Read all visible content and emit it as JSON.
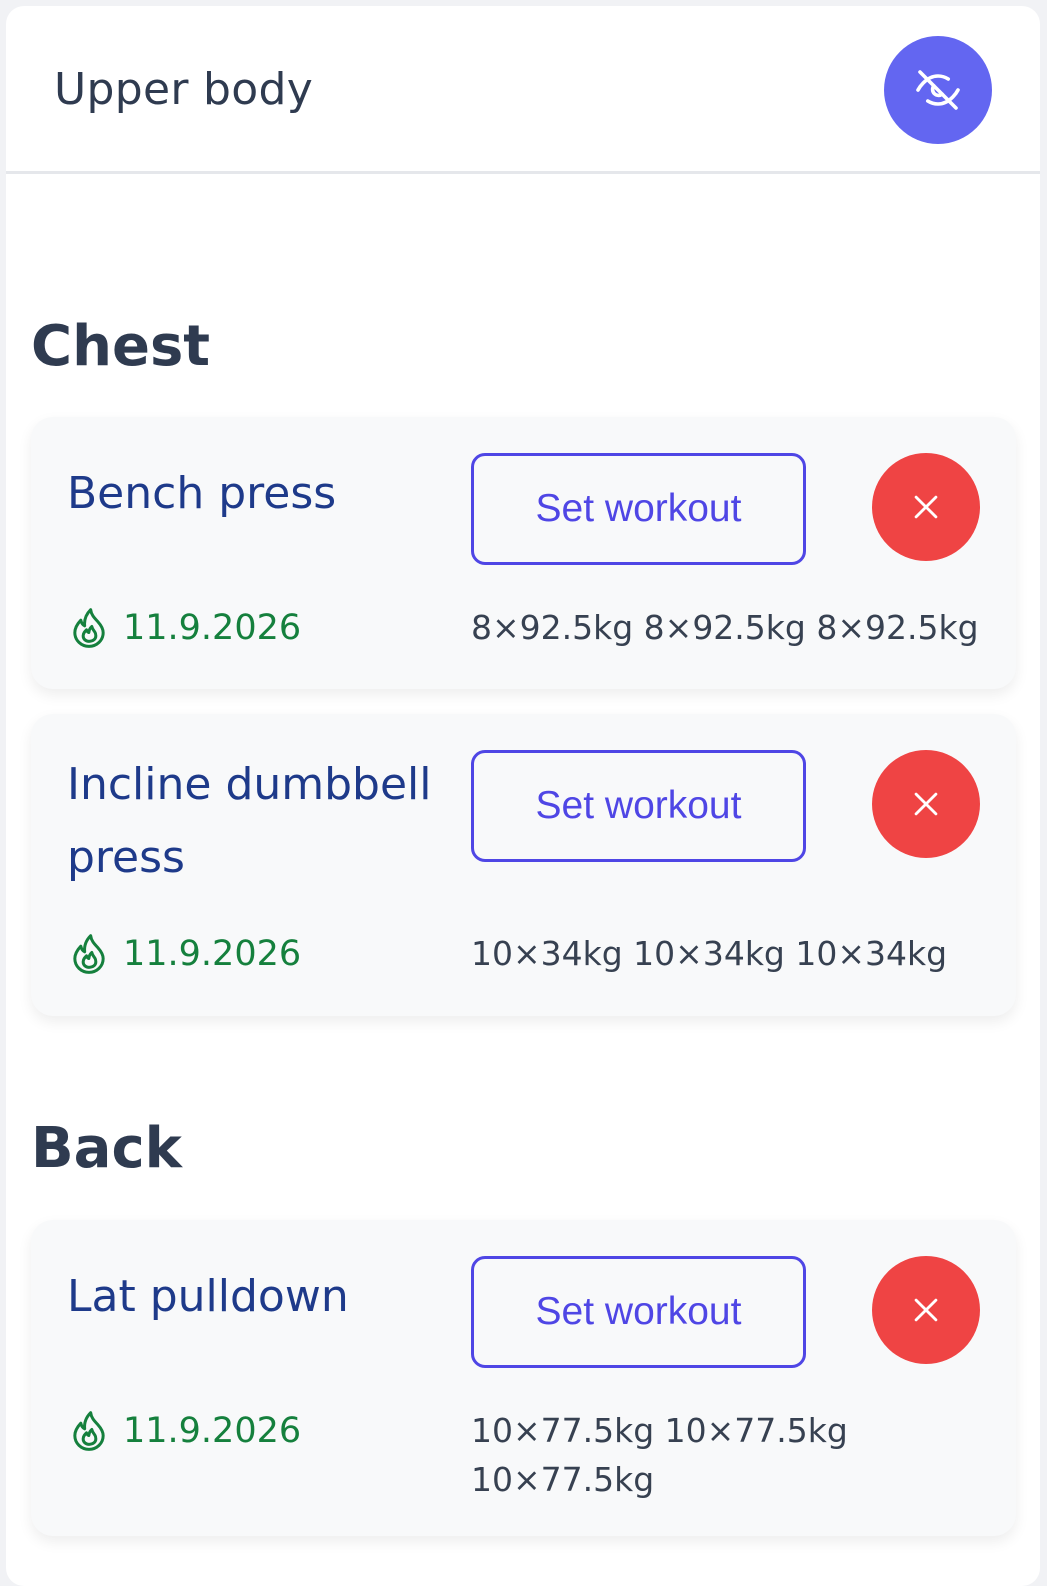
{
  "header": {
    "title": "Upper body",
    "toggle_icon": "eye-off-icon",
    "accent": "#6366f1"
  },
  "sections": [
    {
      "title": "Chest",
      "exercises": [
        {
          "name": "Bench press",
          "button": "Set workout",
          "date": "11.9.2026",
          "sets": "8×92.5kg 8×92.5kg 8×92.5kg"
        },
        {
          "name": "Incline dumbbell press",
          "button": "Set workout",
          "date": "11.9.2026",
          "sets": "10×34kg 10×34kg 10×34kg"
        }
      ]
    },
    {
      "title": "Back",
      "exercises": [
        {
          "name": "Lat pulldown",
          "button": "Set workout",
          "date": "11.9.2026",
          "sets": "10×77.5kg 10×77.5kg 10×77.5kg"
        }
      ]
    }
  ],
  "colors": {
    "delete": "#ef4444",
    "set_button": "#4f46e5",
    "date": "#15803d",
    "exercise_name": "#1e3a8a"
  },
  "icons": {
    "delete": "close-icon",
    "date": "flame-icon"
  }
}
